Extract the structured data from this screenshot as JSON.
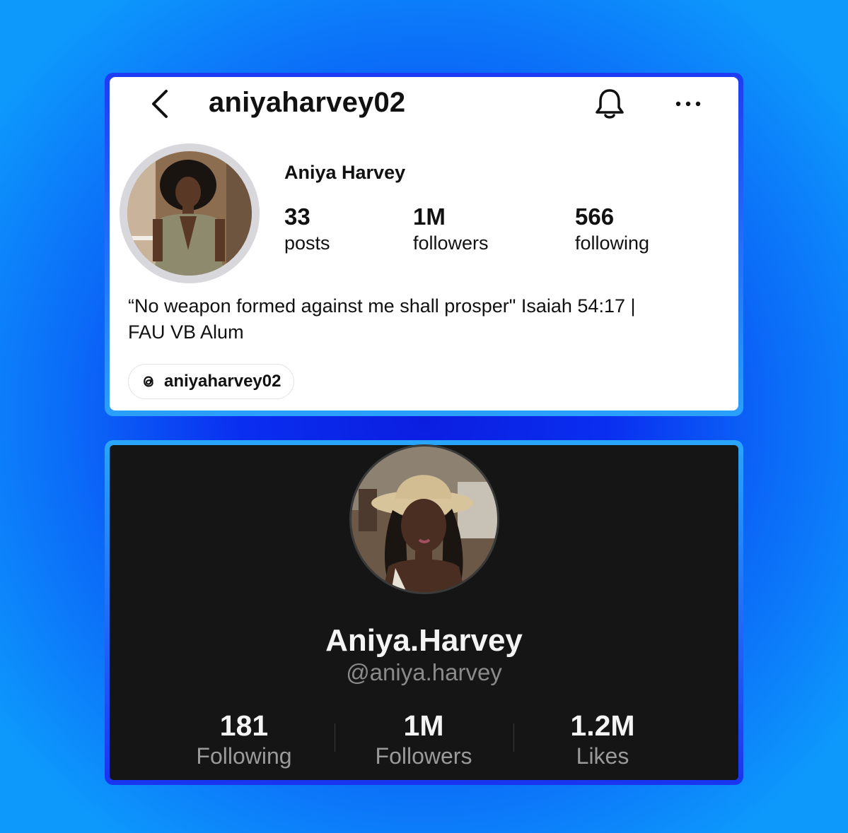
{
  "instagram": {
    "header": {
      "username": "aniyaharvey02",
      "back_icon": "chevron-left-icon",
      "notifications_icon": "bell-icon",
      "more_icon": "more-horizontal-icon"
    },
    "profile": {
      "display_name": "Aniya Harvey",
      "stats": [
        {
          "value": "33",
          "label": "posts"
        },
        {
          "value": "1M",
          "label": "followers"
        },
        {
          "value": "566",
          "label": "following"
        }
      ],
      "bio_line1": "“No weapon formed against me shall prosper\" Isaiah 54:17 |",
      "bio_line2": "FAU VB Alum",
      "threads_handle": "aniyaharvey02",
      "threads_icon": "threads-icon"
    }
  },
  "tiktok": {
    "profile": {
      "display_name": "Aniya.Harvey",
      "handle": "@aniya.harvey",
      "stats": [
        {
          "value": "181",
          "label": "Following"
        },
        {
          "value": "1M",
          "label": "Followers"
        },
        {
          "value": "1.2M",
          "label": "Likes"
        }
      ]
    }
  },
  "colors": {
    "background_center": "#0b1ee0",
    "background_edge": "#0d98fc",
    "instagram_card": "#ffffff",
    "tiktok_card": "#151515",
    "tiktok_handle": "#8a8a8a"
  }
}
